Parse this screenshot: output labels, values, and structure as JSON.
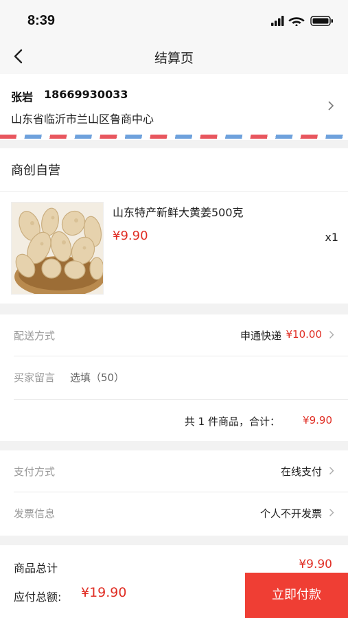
{
  "status_bar": {
    "time": "8:39",
    "icons": [
      "signal-icon",
      "wifi-icon",
      "battery-icon"
    ]
  },
  "nav": {
    "title": "结算页",
    "back_icon": "back-arrow-icon"
  },
  "address": {
    "name": "张岩",
    "phone": "18669930033",
    "detail": "山东省临沂市兰山区鲁商中心",
    "chevron_icon": "chevron-right-icon"
  },
  "order": {
    "shop_name": "商创自营",
    "product": {
      "title": "山东特产新鲜大黄姜500克",
      "price": "¥9.90",
      "quantity": "x1",
      "image": "ginger-product-image"
    }
  },
  "delivery": {
    "method_label": "配送方式",
    "method_value": "申通快递",
    "method_fee": "¥10.00",
    "message_label": "买家留言",
    "message_placeholder": "选填（50）",
    "subtotal_text": "共 1 件商品，合计：",
    "subtotal_value": "¥9.90"
  },
  "payment": {
    "pay_method_label": "支付方式",
    "pay_method_value": "在线支付",
    "invoice_label": "发票信息",
    "invoice_value": "个人不开发票"
  },
  "summary": {
    "goods_total_label": "商品总计",
    "goods_total_value": "¥9.90",
    "payable_label": "应付总额:",
    "payable_value": "¥19.90",
    "pay_button_label": "立即付款"
  },
  "colors": {
    "accent_red": "#e02e24",
    "pay_button": "#ef3e34",
    "airmail_red": "#e8565e",
    "airmail_blue": "#6ea1dc"
  }
}
